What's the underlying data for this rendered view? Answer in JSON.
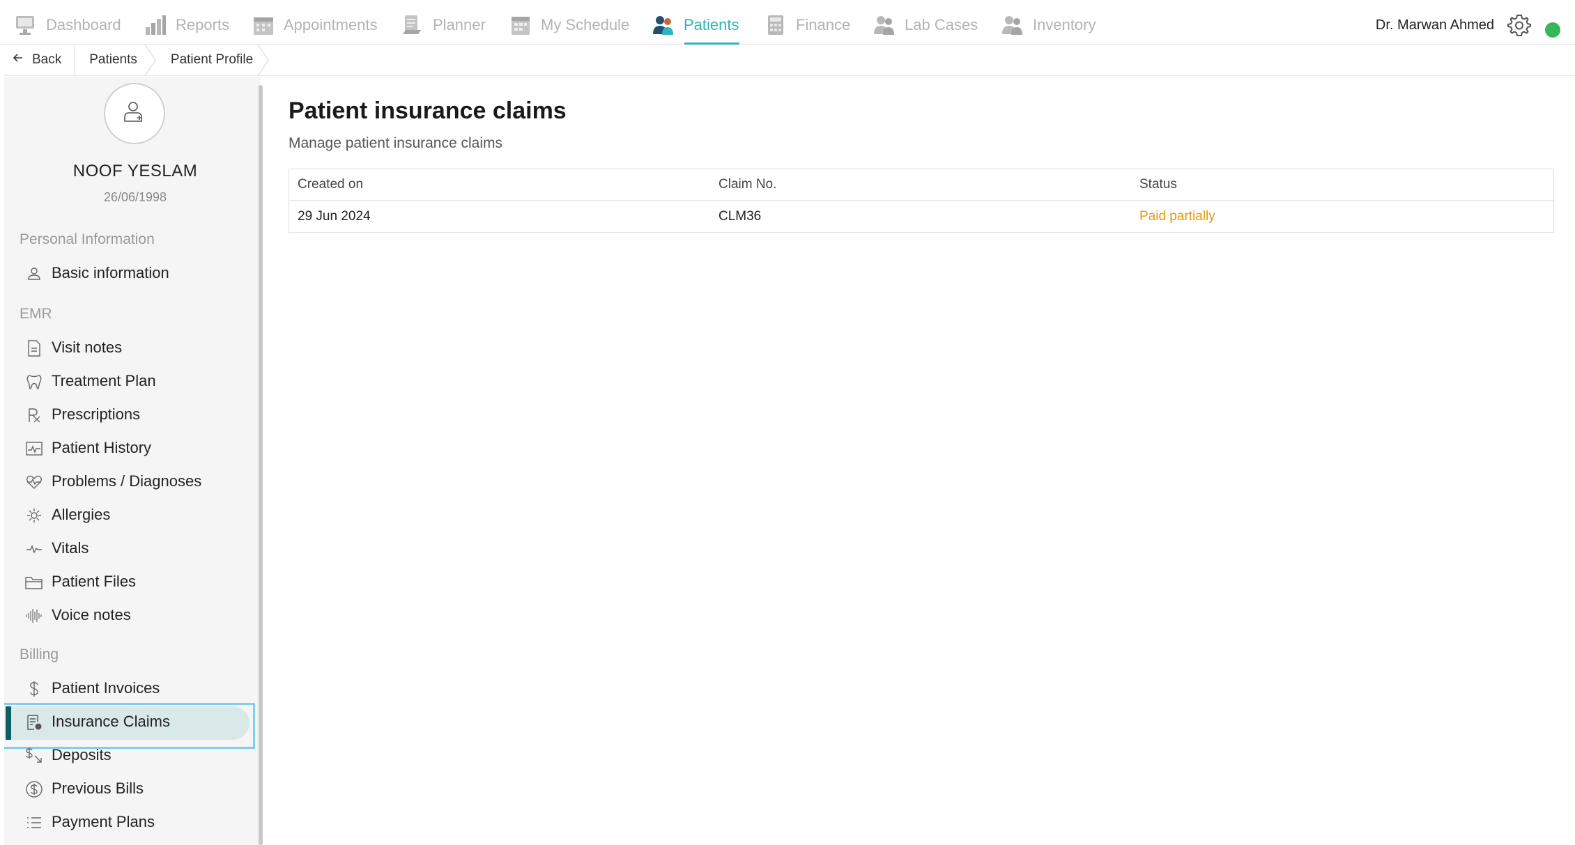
{
  "nav": {
    "items": [
      {
        "label": "Dashboard",
        "icon": "dashboard-icon"
      },
      {
        "label": "Reports",
        "icon": "reports-icon"
      },
      {
        "label": "Appointments",
        "icon": "appointments-icon"
      },
      {
        "label": "Planner",
        "icon": "planner-icon"
      },
      {
        "label": "My Schedule",
        "icon": "schedule-icon"
      },
      {
        "label": "Patients",
        "icon": "patients-icon",
        "active": true
      },
      {
        "label": "Finance",
        "icon": "finance-icon"
      },
      {
        "label": "Lab Cases",
        "icon": "lab-cases-icon"
      },
      {
        "label": "Inventory",
        "icon": "inventory-icon"
      }
    ],
    "user_name": "Dr. Marwan Ahmed",
    "accent_color": "#2fb3bd",
    "status_color": "#3bb55a"
  },
  "breadcrumb": {
    "back_label": "Back",
    "items": [
      "Patients",
      "Patient Profile"
    ]
  },
  "patient": {
    "name": "NOOF YESLAM",
    "dob": "26/06/1998"
  },
  "sidebar": {
    "sections": [
      {
        "title": "Personal Information",
        "items": [
          {
            "label": "Basic information",
            "icon": "person-icon"
          }
        ]
      },
      {
        "title": "EMR",
        "items": [
          {
            "label": "Visit notes",
            "icon": "document-icon"
          },
          {
            "label": "Treatment Plan",
            "icon": "tooth-icon"
          },
          {
            "label": "Prescriptions",
            "icon": "rx-icon"
          },
          {
            "label": "Patient History",
            "icon": "history-chart-icon"
          },
          {
            "label": "Problems / Diagnoses",
            "icon": "heart-pulse-icon"
          },
          {
            "label": "Allergies",
            "icon": "allergy-icon"
          },
          {
            "label": "Vitals",
            "icon": "pulse-icon"
          },
          {
            "label": "Patient Files",
            "icon": "folder-icon"
          },
          {
            "label": "Voice notes",
            "icon": "waveform-icon"
          }
        ]
      },
      {
        "title": "Billing",
        "items": [
          {
            "label": "Patient Invoices",
            "icon": "dollar-icon"
          },
          {
            "label": "Insurance Claims",
            "icon": "claim-icon",
            "active": true
          },
          {
            "label": "Deposits",
            "icon": "deposit-icon"
          },
          {
            "label": "Previous Bills",
            "icon": "dollar-circle-icon"
          },
          {
            "label": "Payment Plans",
            "icon": "list-icon"
          }
        ]
      }
    ]
  },
  "main": {
    "title": "Patient insurance claims",
    "subtitle": "Manage patient insurance claims",
    "table": {
      "columns": [
        "Created on",
        "Claim No.",
        "Status"
      ],
      "rows": [
        {
          "created_on": "29 Jun 2024",
          "claim_no": "CLM36",
          "status": "Paid partially",
          "status_color": "#e39a10"
        }
      ]
    }
  }
}
